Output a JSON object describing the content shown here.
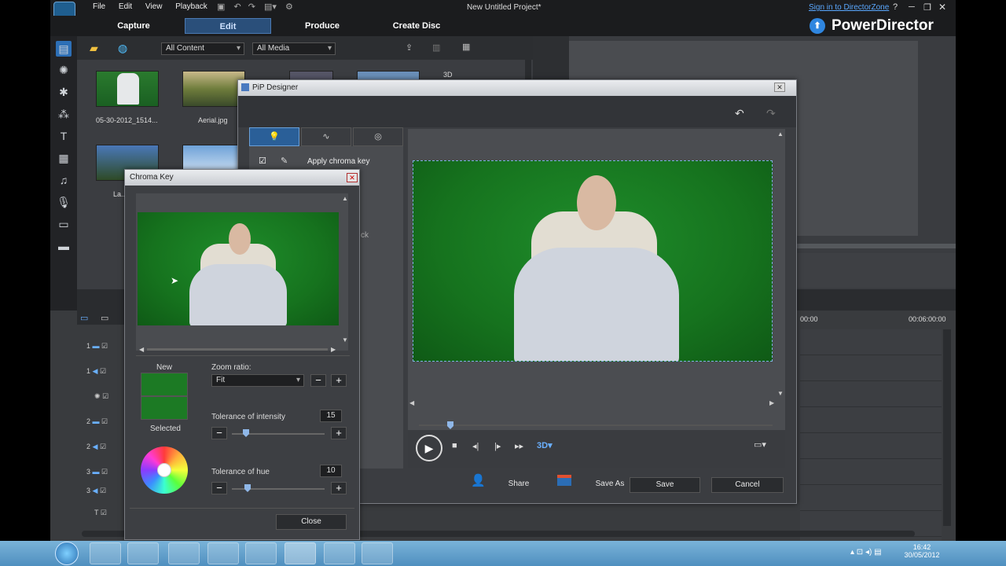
{
  "app": {
    "title": "New Untitled Project*",
    "brand": "PowerDirector",
    "signin_link": "Sign in to DirectorZone",
    "help": "?",
    "menu": [
      "File",
      "Edit",
      "View",
      "Playback"
    ],
    "modes": [
      "Capture",
      "Edit",
      "Produce",
      "Create Disc"
    ],
    "active_mode": "Edit"
  },
  "library": {
    "filter_content": "All Content",
    "filter_media": "All Media",
    "items": [
      {
        "label": "05-30-2012_1514..."
      },
      {
        "label": "Aerial.jpg"
      },
      {
        "label": "La..."
      }
    ],
    "badge_3d": "3D"
  },
  "timeline": {
    "time_start": "00:00",
    "time_end": "00:06:00:00",
    "tracks": [
      "1",
      "1",
      "",
      "2",
      "2",
      "3",
      "3",
      "T"
    ]
  },
  "pip_designer": {
    "title": "PiP Designer",
    "apply_chroma_key": "Apply chroma key",
    "partial_label": "ck",
    "badge_3d": "3D",
    "buttons": {
      "share": "Share",
      "save_as": "Save As",
      "save": "Save",
      "cancel": "Cancel"
    }
  },
  "chroma_key": {
    "title": "Chroma Key",
    "new_label": "New",
    "selected_label": "Selected",
    "zoom_label": "Zoom ratio:",
    "zoom_value": "Fit",
    "tol_intensity_label": "Tolerance of intensity",
    "tol_intensity_value": "15",
    "tol_hue_label": "Tolerance of hue",
    "tol_hue_value": "10",
    "close": "Close",
    "key_color": "#1e7a22"
  },
  "taskbar": {
    "time": "16:42",
    "date": "30/05/2012"
  }
}
